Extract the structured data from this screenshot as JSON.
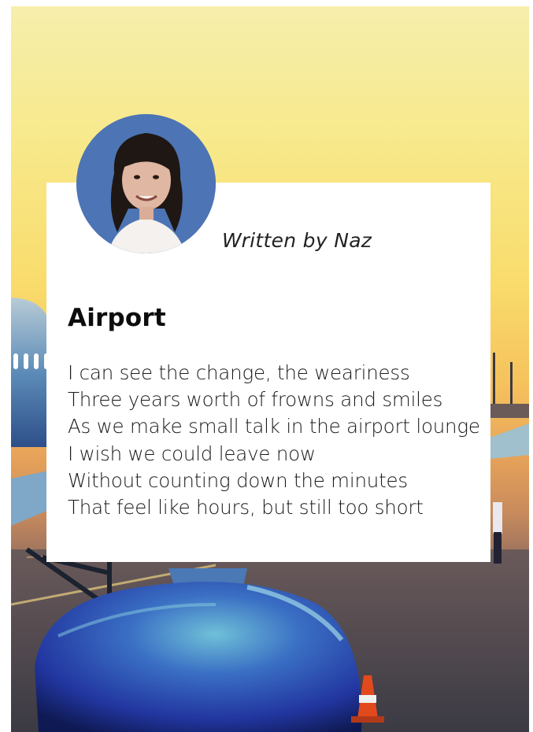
{
  "author": {
    "byline": "Written by Naz"
  },
  "poem": {
    "title": "Airport",
    "lines": [
      "I can see the change, the weariness",
      "Three years worth of frowns and smiles",
      "As we make small talk in the airport lounge",
      "I wish we could leave now",
      "Without counting down the minutes",
      "That feel like hours, but still too short"
    ]
  },
  "colors": {
    "sky_top": "#f6eeac",
    "sky_mid": "#f9dc6c",
    "horizon": "#e7a35a",
    "engine_blue": "#2a4bb0",
    "card": "#ffffff",
    "avatar_bg": "#4d74b4"
  }
}
